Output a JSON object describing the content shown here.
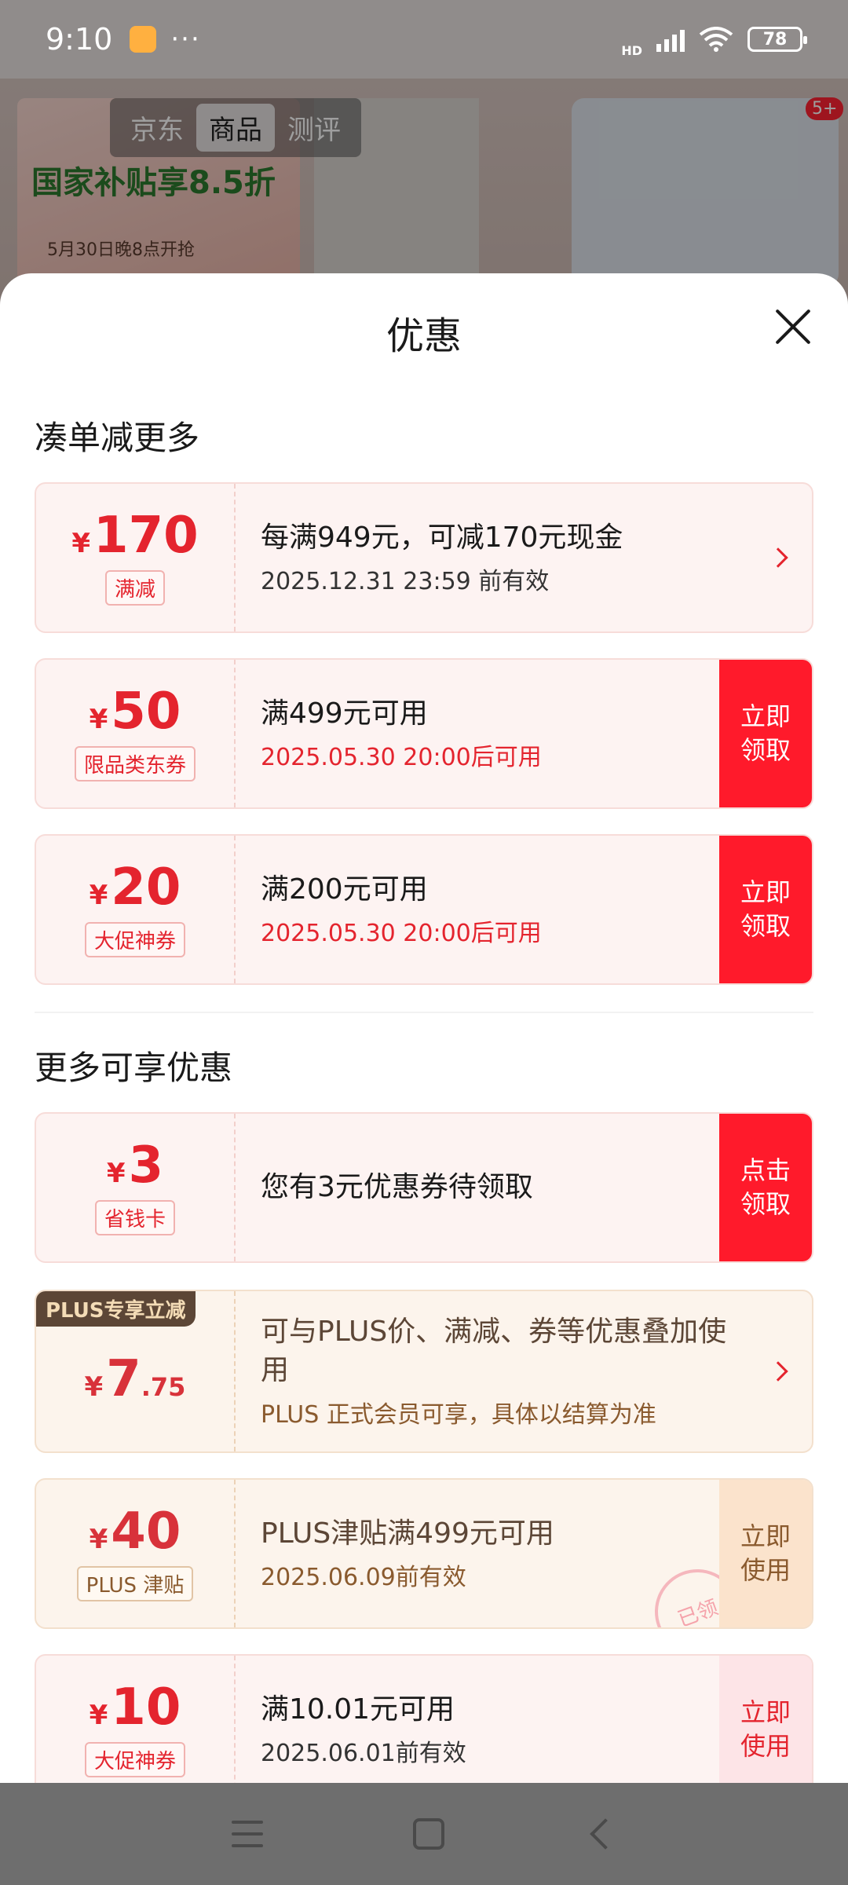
{
  "status_bar": {
    "time": "9:10",
    "more": "···",
    "network": "HD",
    "battery": "78"
  },
  "background": {
    "tabs": [
      "京东",
      "商品",
      "测评"
    ],
    "banner_text": "国家补贴享8.5折",
    "banner_sub": "5月30日晚8点开抢",
    "badge": "5+"
  },
  "sheet": {
    "title": "优惠",
    "section1_title": "凑单减更多",
    "section2_title": "更多可享优惠"
  },
  "coupons": [
    {
      "yen": "¥",
      "amount": "170",
      "tag": "满减",
      "main": "每满949元，可减170元现金",
      "sub": "2025.12.31 23:59 前有效"
    },
    {
      "yen": "¥",
      "amount": "50",
      "tag": "限品类东券",
      "main": "满499元可用",
      "sub": "2025.05.30 20:00后可用",
      "cta": "立即领取"
    },
    {
      "yen": "¥",
      "amount": "20",
      "tag": "大促神券",
      "main": "满200元可用",
      "sub": "2025.05.30 20:00后可用",
      "cta": "立即领取"
    },
    {
      "yen": "¥",
      "amount": "3",
      "tag": "省钱卡",
      "main": "您有3元优惠券待领取",
      "cta": "点击领取"
    },
    {
      "plus_tag": "PLUS专享立减",
      "yen": "¥",
      "amount": "7",
      "amount_dec": ".75",
      "main": "可与PLUS价、满减、券等优惠叠加使用",
      "sub": "PLUS 正式会员可享，具体以结算为准"
    },
    {
      "yen": "¥",
      "amount": "40",
      "tag": "PLUS 津贴",
      "main": "PLUS津贴满499元可用",
      "sub": "2025.06.09前有效",
      "cta": "立即使用",
      "stamp": "已领"
    },
    {
      "yen": "¥",
      "amount": "10",
      "tag": "大促神券",
      "main": "满10.01元可用",
      "sub": "2025.06.01前有效",
      "cta": "立即使用"
    }
  ],
  "colors": {
    "accent_red": "#e4242e",
    "cta_red": "#ff1a2b",
    "gold_text": "#8a5a2e"
  }
}
